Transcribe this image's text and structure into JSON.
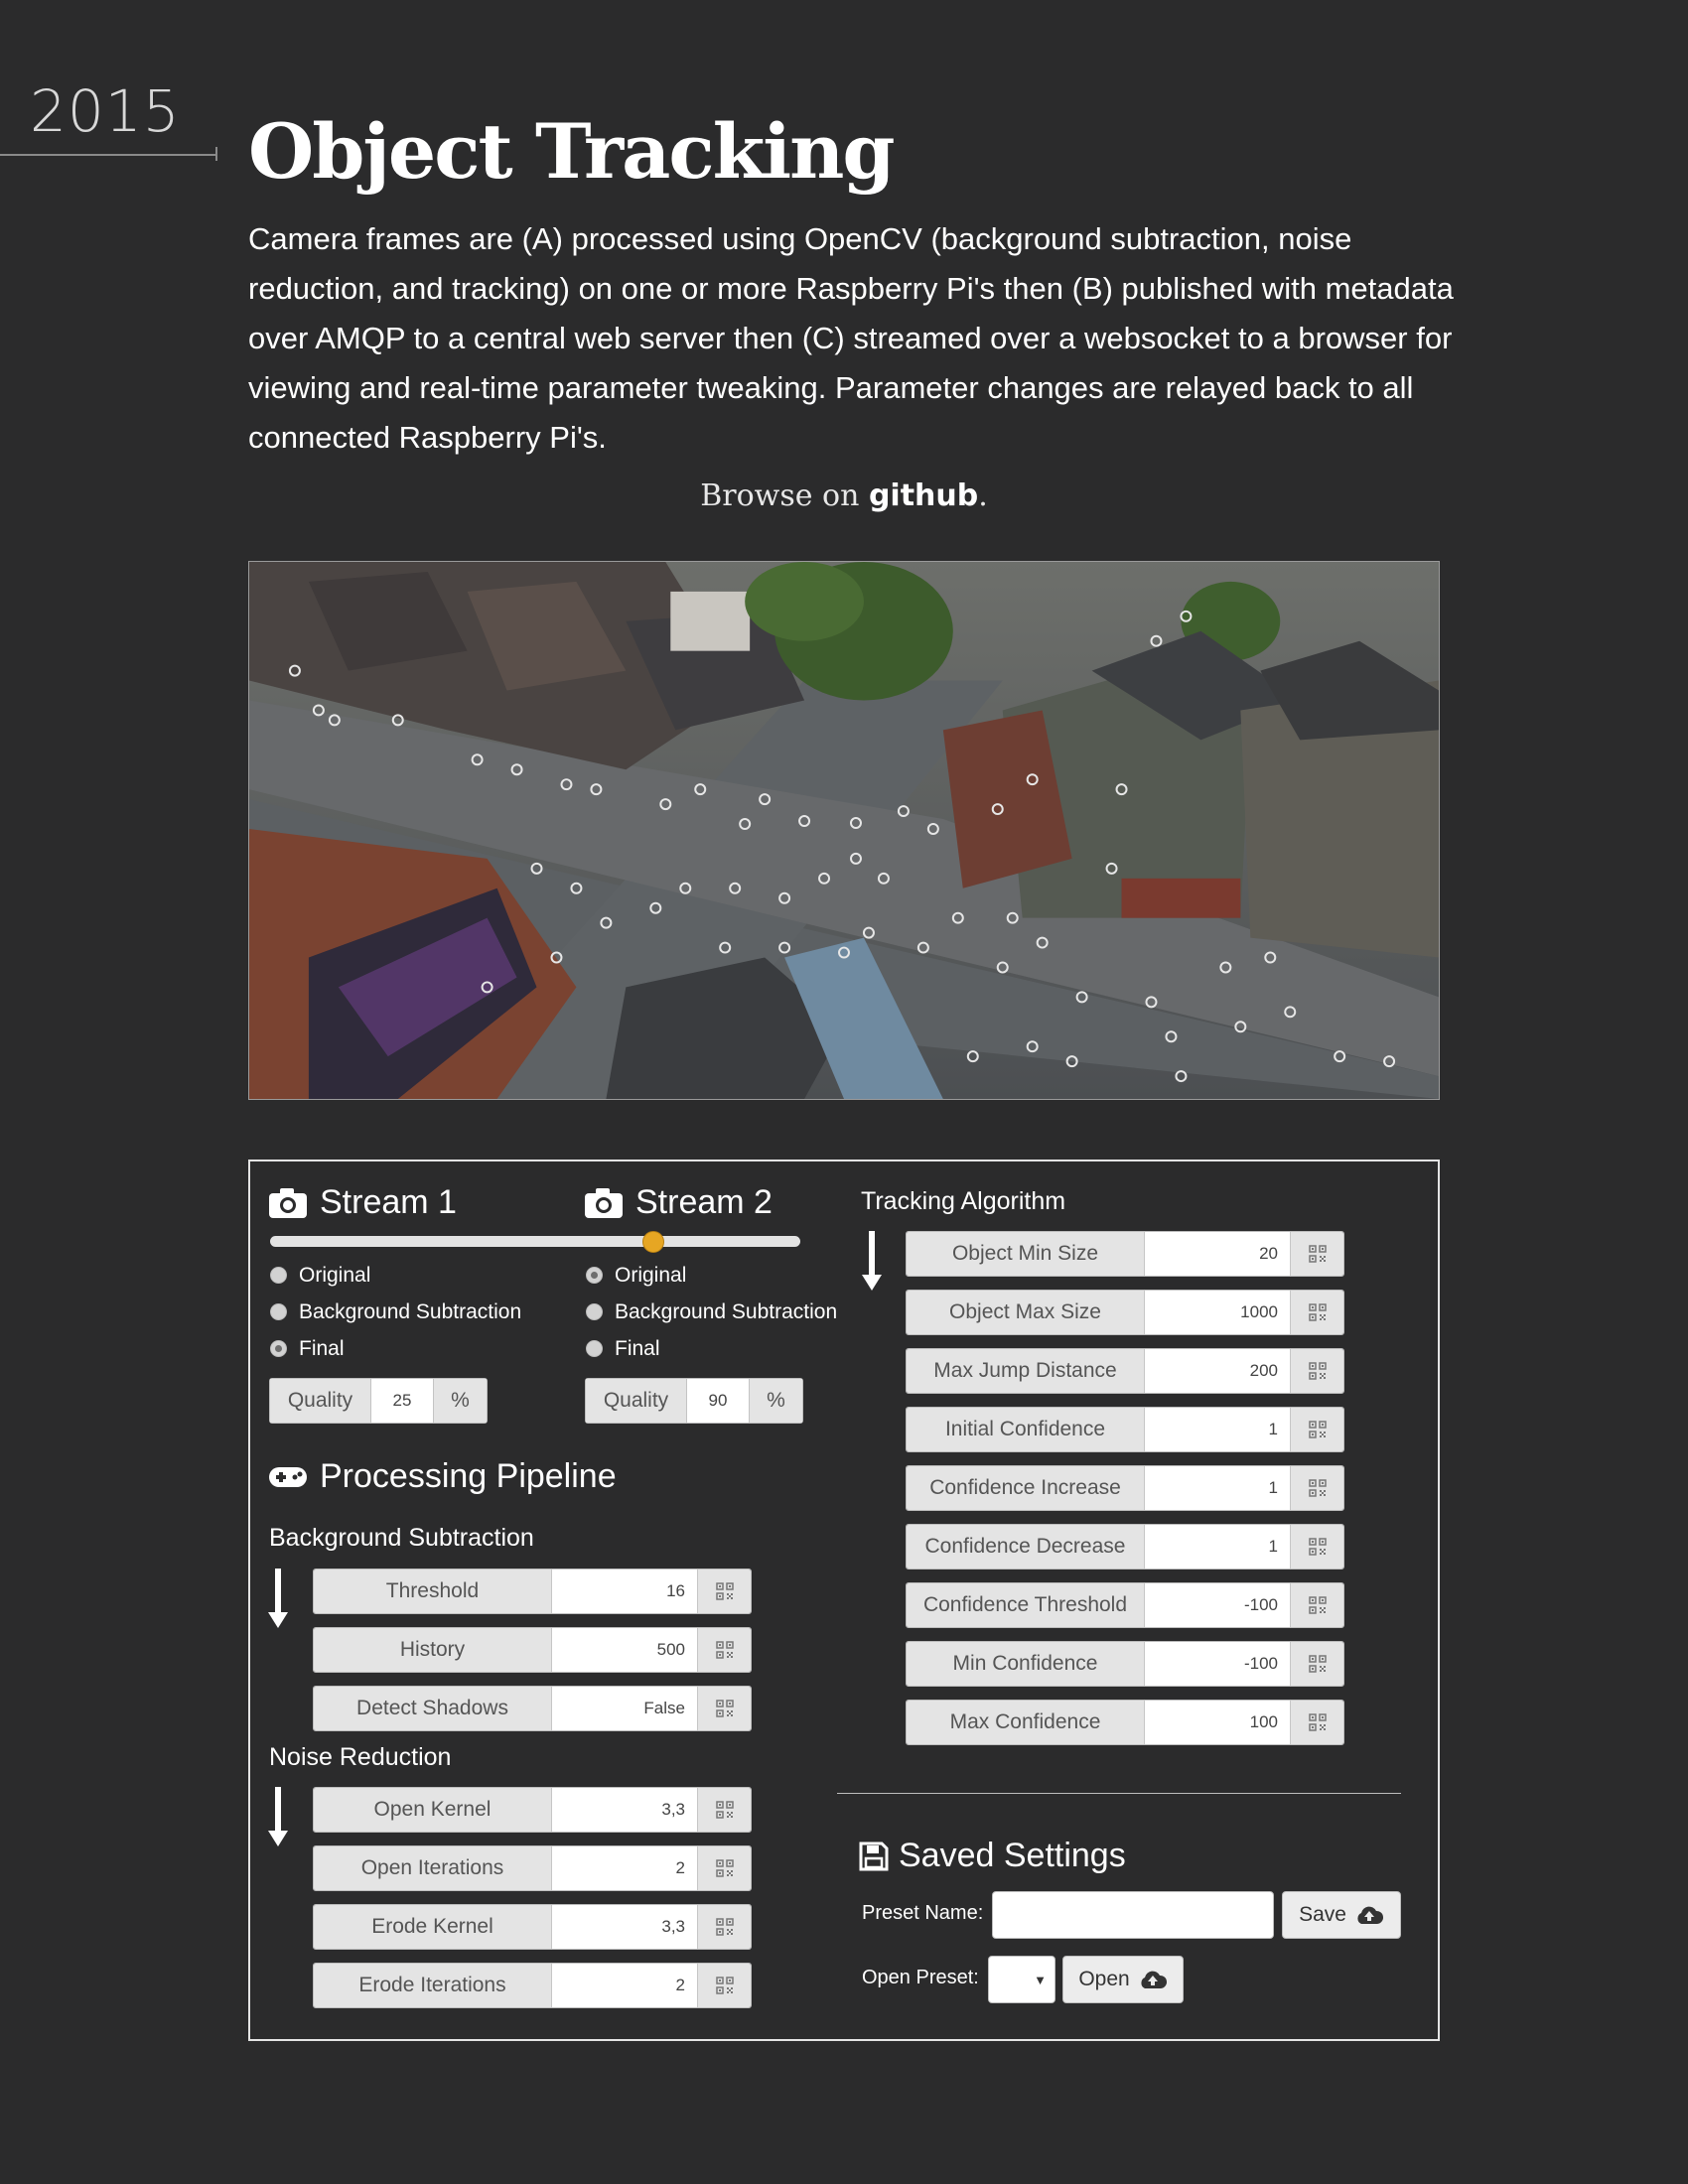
{
  "year": "2015",
  "title": "Object Tracking",
  "description": "Camera frames are (A) processed using OpenCV (background subtraction, noise reduction, and tracking) on one or more Raspberry Pi's then (B) published with metadata over AMQP to a central web server then (C) streamed over a websocket to a browser for viewing and real-time parameter tweaking. Parameter changes are relayed back to all connected Raspberry Pi's.",
  "browse": {
    "prefix": "Browse on ",
    "link": "github",
    "suffix": "."
  },
  "photo": {
    "subject": "aerial view of a city intersection with tracked objects circled",
    "icon": "tracked-object-marker"
  },
  "colors": {
    "background": "#2b2b2c",
    "slider_accent": "#e6a623",
    "panel_border": "#e4e4e4"
  },
  "streams": [
    {
      "title": "Stream 1",
      "icon": "camera-icon",
      "options": [
        "Original",
        "Background Subtraction",
        "Final"
      ],
      "selected": "Final",
      "quality_label": "Quality",
      "quality_value": "25",
      "quality_unit": "%"
    },
    {
      "title": "Stream 2",
      "icon": "camera-icon",
      "options": [
        "Original",
        "Background Subtraction",
        "Final"
      ],
      "selected": "Original",
      "quality_label": "Quality",
      "quality_value": "90",
      "quality_unit": "%"
    }
  ],
  "slider": {
    "value_fraction": 0.74
  },
  "pipeline": {
    "title": "Processing Pipeline",
    "icon": "gamepad-icon",
    "background_subtraction": {
      "title": "Background Subtraction",
      "params": [
        {
          "label": "Threshold",
          "value": "16"
        },
        {
          "label": "History",
          "value": "500"
        },
        {
          "label": "Detect Shadows",
          "value": "False"
        }
      ]
    },
    "noise_reduction": {
      "title": "Noise Reduction",
      "params": [
        {
          "label": "Open Kernel",
          "value": "3,3"
        },
        {
          "label": "Open Iterations",
          "value": "2"
        },
        {
          "label": "Erode Kernel",
          "value": "3,3"
        },
        {
          "label": "Erode Iterations",
          "value": "2"
        }
      ]
    }
  },
  "tracking": {
    "title": "Tracking Algorithm",
    "params": [
      {
        "label": "Object Min Size",
        "value": "20"
      },
      {
        "label": "Object Max Size",
        "value": "1000"
      },
      {
        "label": "Max Jump Distance",
        "value": "200"
      },
      {
        "label": "Initial Confidence",
        "value": "1"
      },
      {
        "label": "Confidence Increase",
        "value": "1"
      },
      {
        "label": "Confidence Decrease",
        "value": "1"
      },
      {
        "label": "Confidence Threshold",
        "value": "-100"
      },
      {
        "label": "Min Confidence",
        "value": "-100"
      },
      {
        "label": "Max Confidence",
        "value": "100"
      }
    ]
  },
  "saved": {
    "title": "Saved Settings",
    "icon": "floppy-disk-icon",
    "preset_name_label": "Preset Name:",
    "preset_name_value": "",
    "save_label": "Save",
    "open_preset_label": "Open Preset:",
    "open_preset_value": "",
    "open_label": "Open"
  }
}
